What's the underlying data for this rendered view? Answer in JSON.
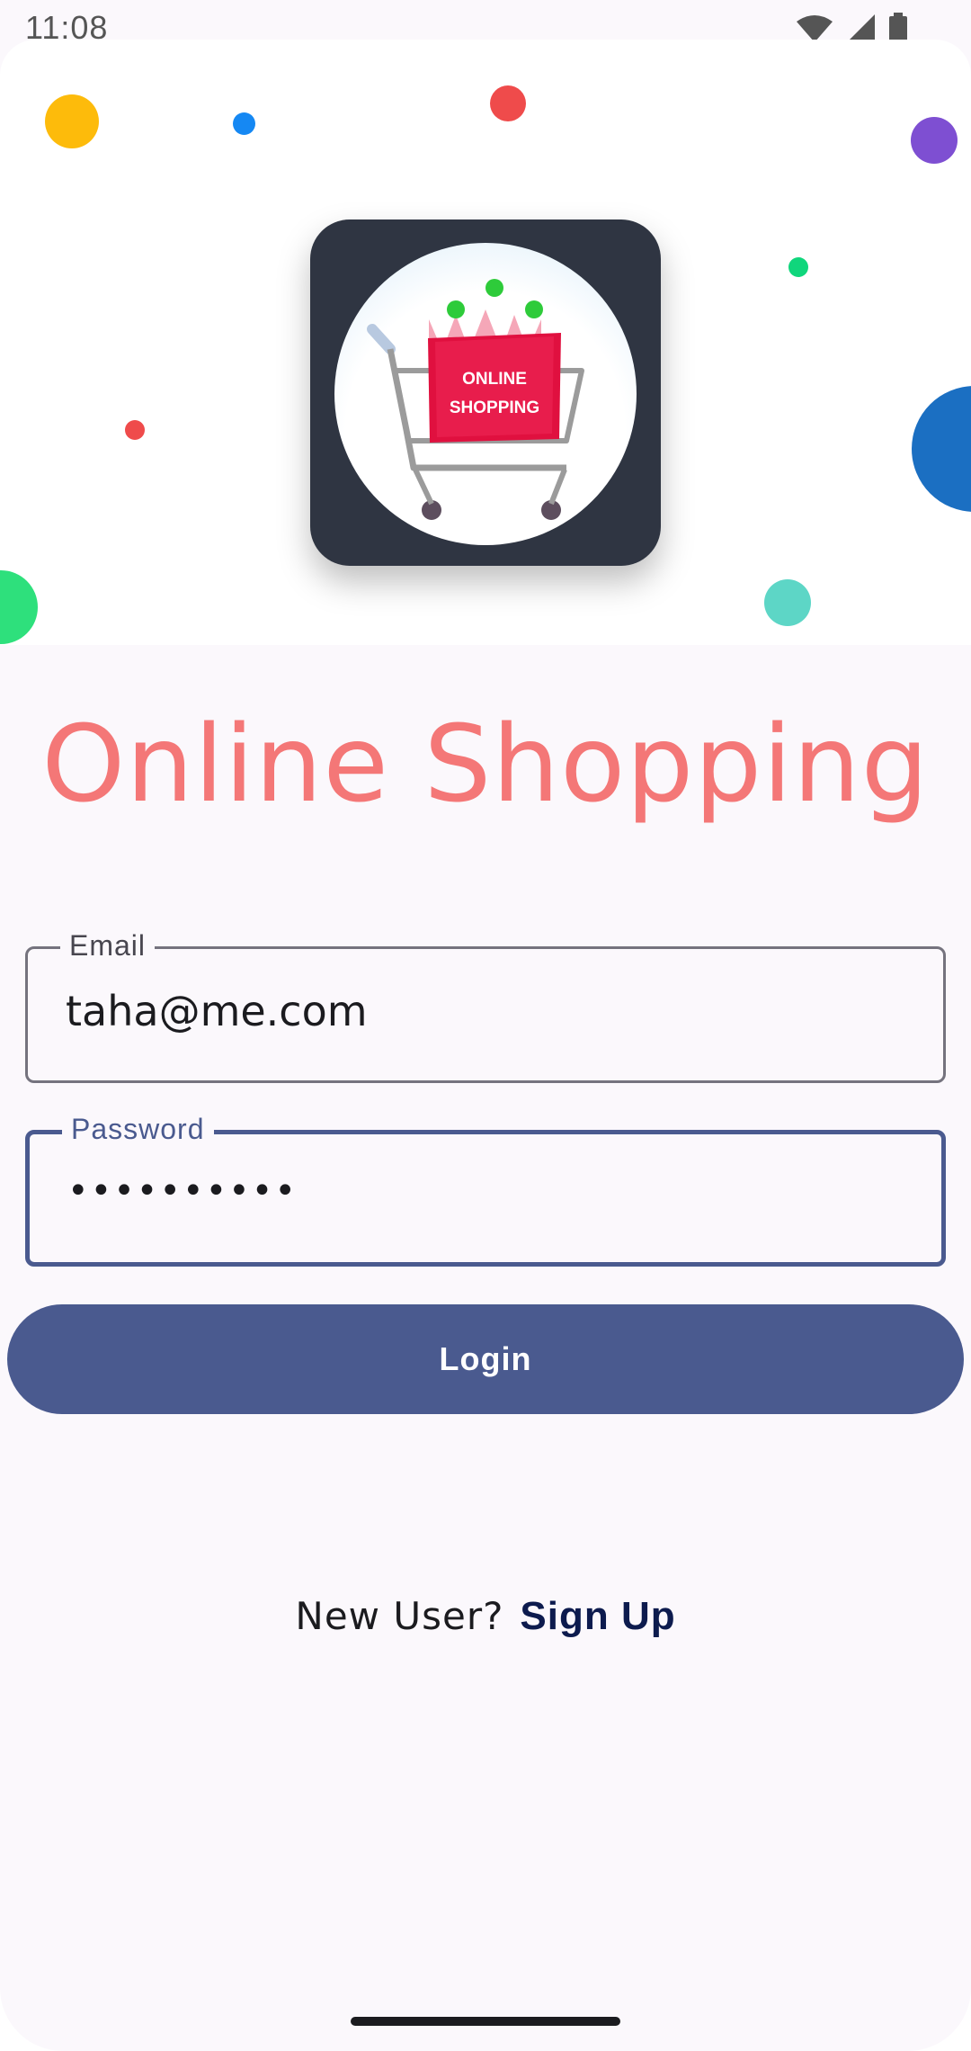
{
  "status_bar": {
    "time": "11:08",
    "icons": [
      "wifi-icon",
      "signal-icon",
      "battery-icon"
    ]
  },
  "header": {
    "logo_line1": "ONLINE",
    "logo_line2": "SHOPPING",
    "logo_icon": "shopping-cart-icon"
  },
  "title": "Online Shopping",
  "form": {
    "email_label": "Email",
    "email_value": "taha@me.com",
    "password_label": "Password",
    "password_value": "••••••••••"
  },
  "login_label": "Login",
  "signup": {
    "prompt": "New User?",
    "link": "Sign Up"
  },
  "colors": {
    "title": "#f47777",
    "primary": "#4a5a8f",
    "signup_link": "#0d1b4e",
    "logo_background": "#2f3542"
  }
}
